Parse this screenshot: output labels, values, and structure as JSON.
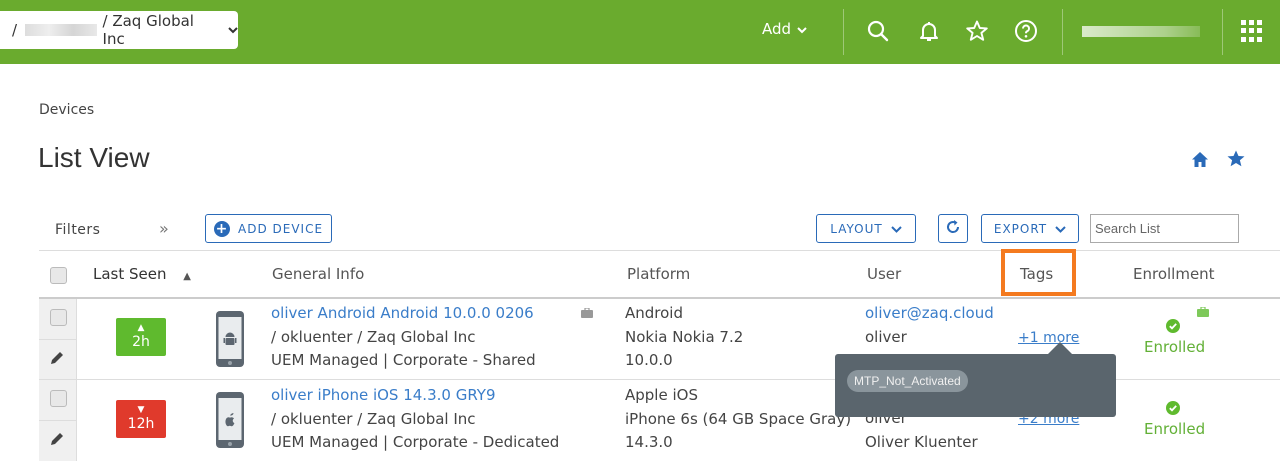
{
  "topbar": {
    "org_prefix": "/",
    "org_name": "/ Zaq Global Inc",
    "add_label": "Add",
    "colors": {
      "bar": "#6aab2e"
    }
  },
  "breadcrumb": "Devices",
  "page_title": "List View",
  "toolbar": {
    "filters_label": "Filters",
    "expand_glyph": "»",
    "add_device_label": "ADD DEVICE",
    "layout_label": "LAYOUT",
    "export_label": "EXPORT",
    "search_placeholder": "Search List"
  },
  "table": {
    "columns": {
      "last_seen": "Last Seen",
      "general_info": "General Info",
      "platform": "Platform",
      "user": "User",
      "tags": "Tags",
      "enrollment": "Enrollment"
    },
    "rows": [
      {
        "last_seen": "2h",
        "last_seen_trend": "up",
        "last_seen_color": "#5fba2e",
        "device_icon": "android-phone-icon",
        "name": "oliver Android Android 10.0.0 0206",
        "path": "/ okluenter / Zaq Global Inc",
        "management": "UEM Managed | Corporate - Shared",
        "platform": "Android",
        "model": "Nokia Nokia 7.2",
        "os_version": "10.0.0",
        "user_email": "oliver@zaq.cloud",
        "user_name": "oliver",
        "tags_link": "+1 more",
        "enrollment": "Enrolled"
      },
      {
        "last_seen": "12h",
        "last_seen_trend": "down",
        "last_seen_color": "#e03a2c",
        "device_icon": "apple-phone-icon",
        "name": "oliver iPhone iOS 14.3.0 GRY9",
        "path": "/ okluenter / Zaq Global Inc",
        "management": "UEM Managed | Corporate - Dedicated",
        "platform": "Apple iOS",
        "model": "iPhone 6s (64 GB Space Gray)",
        "os_version": "14.3.0",
        "user_email": "oliver",
        "user_name": "Oliver Kluenter",
        "tags_link": "+2 more",
        "enrollment": "Enrolled"
      }
    ]
  },
  "tooltip": {
    "tag": "MTP_Not_Activated"
  }
}
